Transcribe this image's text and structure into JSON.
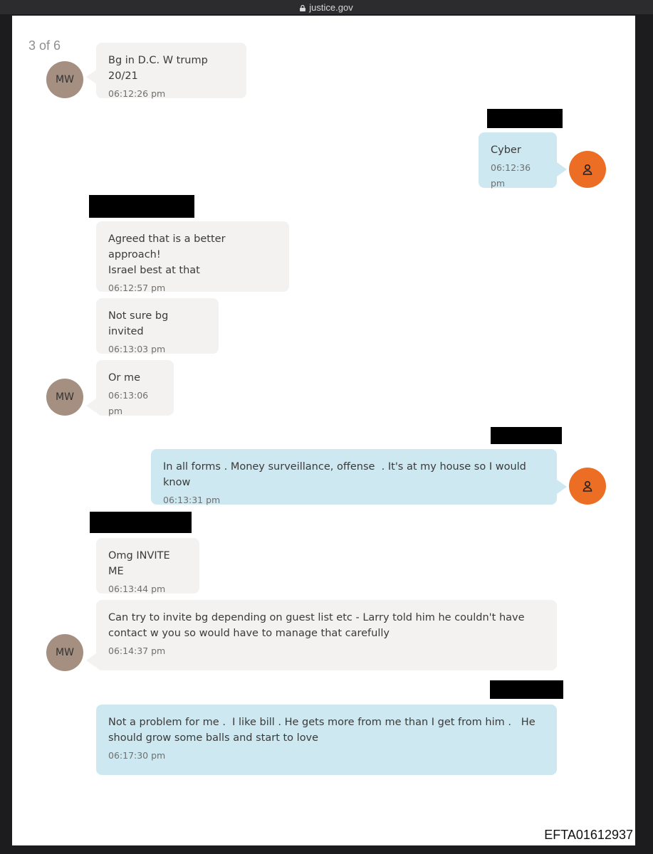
{
  "browser": {
    "url": "justice.gov"
  },
  "page_indicator": "3 of 6",
  "avatar_initials": "MW",
  "messages": [
    {
      "text": "Bg in D.C. W trump 20/21",
      "time": "06:12:26 pm"
    },
    {
      "text": "Cyber",
      "time": "06:12:36 pm"
    },
    {
      "text": "Agreed that is a better approach!\nIsrael best at that",
      "time": "06:12:57 pm"
    },
    {
      "text": "Not sure bg invited",
      "time": "06:13:03 pm"
    },
    {
      "text": "Or me",
      "time": "06:13:06 pm"
    },
    {
      "text": "In all forms . Money surveillance, offense  . It's at my house so I would know",
      "time": "06:13:31 pm"
    },
    {
      "text": "Omg INVITE ME",
      "time": "06:13:44 pm"
    },
    {
      "text": "Can try to invite bg depending on guest list etc - Larry told him he couldn't have\ncontact w you so would have to manage that carefully",
      "time": "06:14:37 pm"
    },
    {
      "text": "Not a problem for me .  I like bill . He gets more from me than I get from him .   He\nshould grow some balls and start to love",
      "time": "06:17:30 pm"
    }
  ],
  "document_id": "EFTA01612937",
  "colors": {
    "incoming_bubble": "#f3f2f0",
    "outgoing_bubble": "#cde8f0",
    "mw_avatar": "#a48f80",
    "user_avatar": "#ec6d24"
  },
  "icons": {
    "lock": "lock-icon",
    "user": "user-icon"
  }
}
